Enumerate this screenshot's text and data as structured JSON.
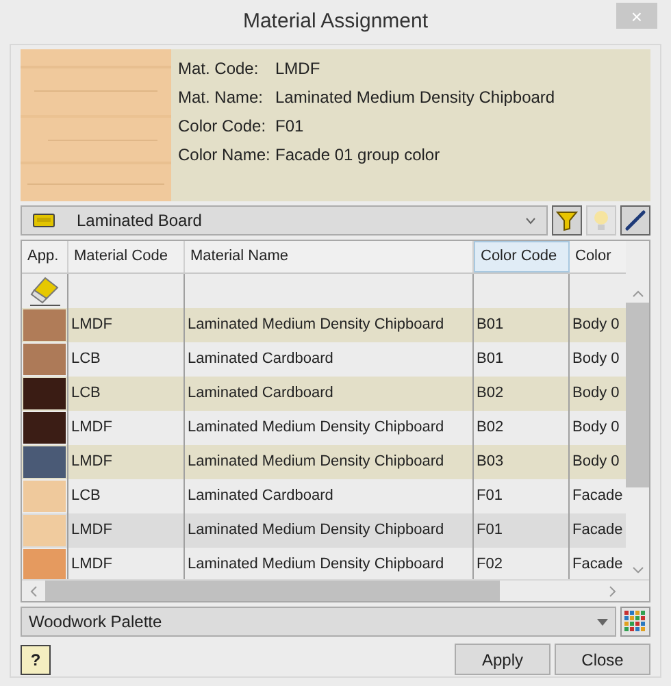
{
  "window": {
    "title": "Material Assignment",
    "close": "×"
  },
  "info": [
    {
      "label": "Mat. Code:",
      "value": "LMDF"
    },
    {
      "label": "Mat. Name:",
      "value": "Laminated Medium Density Chipboard"
    },
    {
      "label": "Color Code:",
      "value": "F01"
    },
    {
      "label": "Color Name:",
      "value": "Facade 01 group color"
    }
  ],
  "category": {
    "value": "Laminated Board"
  },
  "table": {
    "columns": [
      "App.",
      "Material Code",
      "Material Name",
      "Color Code",
      "Color"
    ],
    "rows": [
      {
        "color": "#b07c58",
        "material_code": "LMDF",
        "material_name": "Laminated Medium Density Chipboard",
        "color_code": "B01",
        "color_name": "Body 0",
        "selected": false
      },
      {
        "color": "#ad7a58",
        "material_code": "LCB",
        "material_name": "Laminated Cardboard",
        "color_code": "B01",
        "color_name": "Body 0",
        "selected": false
      },
      {
        "color": "#3a1c14",
        "material_code": "LCB",
        "material_name": "Laminated Cardboard",
        "color_code": "B02",
        "color_name": "Body 0",
        "selected": false
      },
      {
        "color": "#3b1d15",
        "material_code": "LMDF",
        "material_name": "Laminated Medium Density Chipboard",
        "color_code": "B02",
        "color_name": "Body 0",
        "selected": false
      },
      {
        "color": "#4a5a76",
        "material_code": "LMDF",
        "material_name": "Laminated Medium Density Chipboard",
        "color_code": "B03",
        "color_name": "Body 0",
        "selected": false
      },
      {
        "color": "#efc99c",
        "material_code": "LCB",
        "material_name": "Laminated Cardboard",
        "color_code": "F01",
        "color_name": "Facade",
        "selected": false
      },
      {
        "color": "#f0cb9e",
        "material_code": "LMDF",
        "material_name": "Laminated Medium Density Chipboard",
        "color_code": "F01",
        "color_name": "Facade",
        "selected": true
      },
      {
        "color": "#e59a5f",
        "material_code": "LMDF",
        "material_name": "Laminated Medium Density Chipboard",
        "color_code": "F02",
        "color_name": "Facade",
        "selected": false
      }
    ]
  },
  "palette": {
    "value": "Woodwork Palette"
  },
  "buttons": [
    "Apply",
    "Close"
  ],
  "help": "?"
}
